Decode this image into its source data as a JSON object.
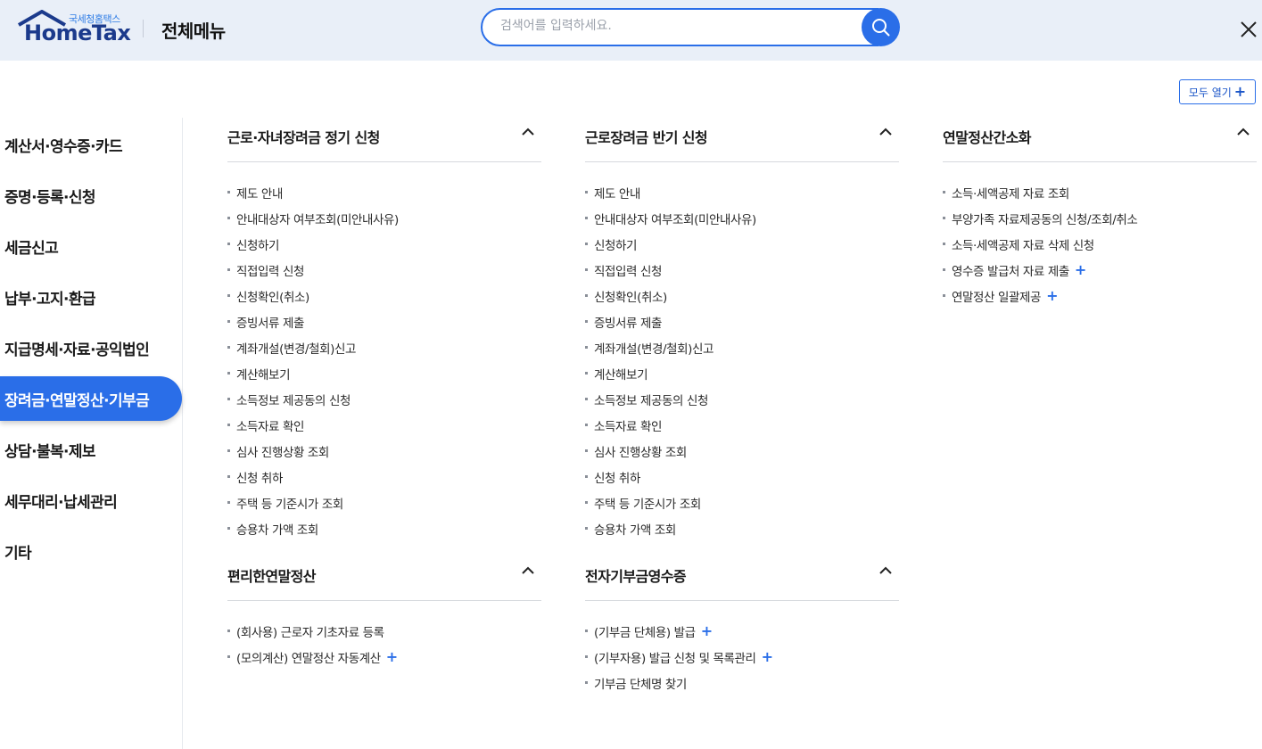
{
  "header": {
    "logo_sub": "국세청홈택스",
    "logo_main": "HomeTax",
    "title": "전체메뉴",
    "search_placeholder": "검색어를 입력하세요.",
    "search_value": ""
  },
  "toolbar": {
    "open_all_label": "모두 열기",
    "plus": "+"
  },
  "sidebar": {
    "items": [
      {
        "label": "계산서·영수증·카드"
      },
      {
        "label": "증명·등록·신청"
      },
      {
        "label": "세금신고"
      },
      {
        "label": "납부·고지·환급"
      },
      {
        "label": "지급명세·자료·공익법인"
      },
      {
        "label": "장려금·연말정산·기부금",
        "active": true
      },
      {
        "label": "상담·불복·제보"
      },
      {
        "label": "세무대리·납세관리"
      },
      {
        "label": "기타"
      }
    ]
  },
  "sections": [
    {
      "title": "근로·자녀장려금 정기 신청",
      "items": [
        {
          "label": "제도 안내"
        },
        {
          "label": "안내대상자 여부조회(미안내사유)"
        },
        {
          "label": "신청하기"
        },
        {
          "label": "직접입력 신청"
        },
        {
          "label": "신청확인(취소)"
        },
        {
          "label": "증빙서류 제출"
        },
        {
          "label": "계좌개설(변경/철회)신고"
        },
        {
          "label": "계산해보기"
        },
        {
          "label": "소득정보 제공동의 신청"
        },
        {
          "label": "소득자료 확인"
        },
        {
          "label": "심사 진행상황 조회"
        },
        {
          "label": "신청 취하"
        },
        {
          "label": "주택 등 기준시가 조회"
        },
        {
          "label": "승용차 가액 조회"
        }
      ]
    },
    {
      "title": "근로장려금 반기 신청",
      "items": [
        {
          "label": "제도 안내"
        },
        {
          "label": "안내대상자 여부조회(미안내사유)"
        },
        {
          "label": "신청하기"
        },
        {
          "label": "직접입력 신청"
        },
        {
          "label": "신청확인(취소)"
        },
        {
          "label": "증빙서류 제출"
        },
        {
          "label": "계좌개설(변경/철회)신고"
        },
        {
          "label": "계산해보기"
        },
        {
          "label": "소득정보 제공동의 신청"
        },
        {
          "label": "소득자료 확인"
        },
        {
          "label": "심사 진행상황 조회"
        },
        {
          "label": "신청 취하"
        },
        {
          "label": "주택 등 기준시가 조회"
        },
        {
          "label": "승용차 가액 조회"
        }
      ]
    },
    {
      "title": "연말정산간소화",
      "items": [
        {
          "label": "소득·세액공제 자료 조회"
        },
        {
          "label": "부양가족 자료제공동의 신청/조회/취소"
        },
        {
          "label": "소득·세액공제 자료 삭제 신청"
        },
        {
          "label": "영수증 발급처 자료 제출",
          "expandable": true
        },
        {
          "label": "연말정산 일괄제공",
          "expandable": true
        }
      ]
    },
    {
      "title": "편리한연말정산",
      "items": [
        {
          "label": "(회사용) 근로자 기초자료 등록"
        },
        {
          "label": "(모의계산) 연말정산 자동계산",
          "expandable": true
        }
      ]
    },
    {
      "title": "전자기부금영수증",
      "items": [
        {
          "label": "(기부금 단체용) 발급",
          "expandable": true
        },
        {
          "label": "(기부자용) 발급 신청 및 목록관리",
          "expandable": true
        },
        {
          "label": "기부금 단체명 찾기"
        }
      ]
    }
  ],
  "icons": {
    "search": "search-icon",
    "close": "close-icon",
    "collapse": "chevron-up-icon",
    "home": "house-icon"
  },
  "colors": {
    "accent": "#2a6ee8",
    "header_bg": "#e9eff8",
    "brand": "#1b3a8c"
  }
}
